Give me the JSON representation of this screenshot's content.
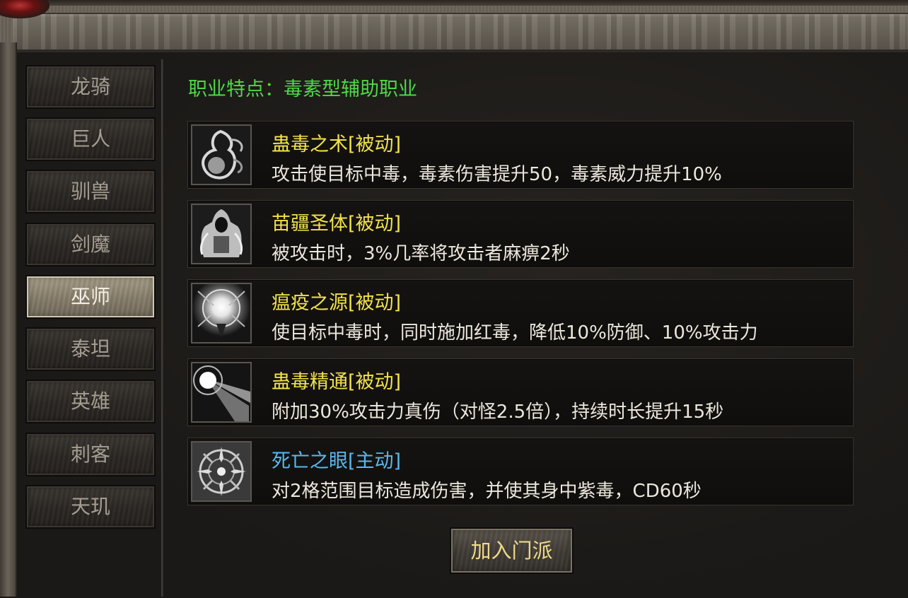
{
  "tabs": [
    {
      "label": "龙骑",
      "active": false
    },
    {
      "label": "巨人",
      "active": false
    },
    {
      "label": "驯兽",
      "active": false
    },
    {
      "label": "剑魔",
      "active": false
    },
    {
      "label": "巫师",
      "active": true
    },
    {
      "label": "泰坦",
      "active": false
    },
    {
      "label": "英雄",
      "active": false
    },
    {
      "label": "刺客",
      "active": false
    },
    {
      "label": "天玑",
      "active": false
    }
  ],
  "class_feature": "职业特点：毒素型辅助职业",
  "skills": [
    {
      "name": "蛊毒之术[被动]",
      "desc": "攻击使目标中毒，毒素伤害提升50，毒素威力提升10%",
      "name_color": "#f2e24a",
      "icon": "poison-gourd-icon"
    },
    {
      "name": "苗疆圣体[被动]",
      "desc": "被攻击时，3%几率将攻击者麻痹2秒",
      "name_color": "#f2e24a",
      "icon": "hooded-figure-icon"
    },
    {
      "name": "瘟疫之源[被动]",
      "desc": "使目标中毒时，同时施加红毒，降低10%防御、10%攻击力",
      "name_color": "#f2e24a",
      "icon": "glowing-orb-icon"
    },
    {
      "name": "蛊毒精通[被动]",
      "desc": "附加30%攻击力真伤（对怪2.5倍），持续时长提升15秒",
      "name_color": "#f2e24a",
      "icon": "light-beam-icon"
    },
    {
      "name": "死亡之眼[主动]",
      "desc": "对2格范围目标造成伤害，并使其身中紫毒，CD60秒",
      "name_color": "#5ab8ee",
      "icon": "eye-sigil-icon"
    }
  ],
  "join_button": "加入门派",
  "colors": {
    "class_feature": "#4fd847",
    "passive_skill": "#f2e24a",
    "active_skill": "#5ab8ee",
    "button_text": "#f0d98a"
  }
}
